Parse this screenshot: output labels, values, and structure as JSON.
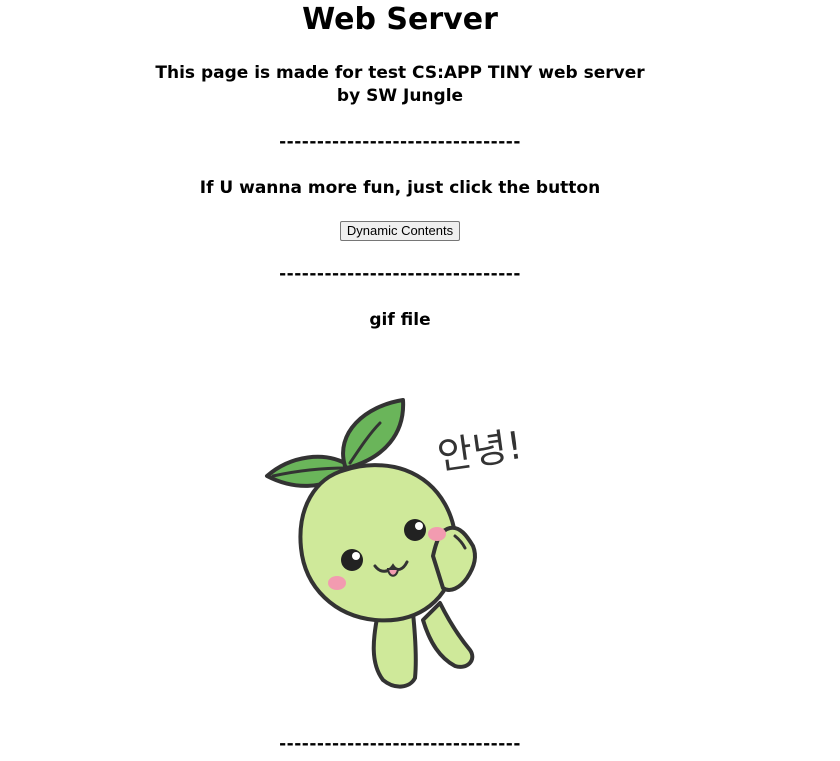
{
  "page": {
    "title": "Web Server",
    "subtitle_line1": "This page is made for test CS:APP TINY web server",
    "subtitle_line2": "by SW Jungle",
    "divider": "--------------------------------",
    "fun_text": "If U wanna more fun, just click the button",
    "button_label": "Dynamic Contents",
    "gif_label": "gif file"
  },
  "gif": {
    "greeting": "안녕!",
    "colors": {
      "body": "#cfe99a",
      "leaf": "#6ab55a",
      "outline": "#333333",
      "blush": "#f29bb0"
    }
  }
}
